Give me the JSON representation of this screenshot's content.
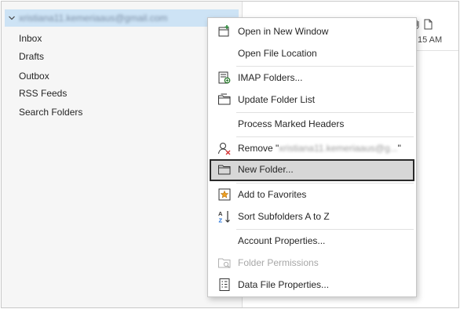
{
  "folder_pane": {
    "account_name": "xristiana11.kemeriaaus@gmail.com",
    "folders": [
      "Inbox",
      "Drafts",
      "Outbox",
      "RSS Feeds",
      "Search Folders"
    ]
  },
  "right_pane": {
    "time_fragment": "15 AM"
  },
  "context_menu": {
    "items": [
      {
        "label": "Open in New Window",
        "icon": "open-new-window-icon"
      },
      {
        "label": "Open File Location",
        "icon": ""
      },
      {
        "label": "IMAP Folders...",
        "icon": "imap-folders-icon"
      },
      {
        "label": "Update Folder List",
        "icon": "update-folder-list-icon"
      },
      {
        "label": "Process Marked Headers",
        "icon": ""
      },
      {
        "label": "Remove \"",
        "label_tail": "xristiana11.kemeriaaus@g...",
        "label_end": "\"",
        "icon": "remove-person-icon"
      },
      {
        "label": "New Folder...",
        "icon": "new-folder-icon",
        "state": "highlighted"
      },
      {
        "label": "Add to Favorites",
        "icon": "add-favorite-icon"
      },
      {
        "label": "Sort Subfolders A to Z",
        "icon": "sort-az-icon"
      },
      {
        "label": "Account Properties...",
        "icon": ""
      },
      {
        "label": "Folder Permissions",
        "icon": "folder-permissions-icon",
        "state": "disabled"
      },
      {
        "label": "Data File Properties...",
        "icon": "data-file-properties-icon"
      }
    ]
  }
}
